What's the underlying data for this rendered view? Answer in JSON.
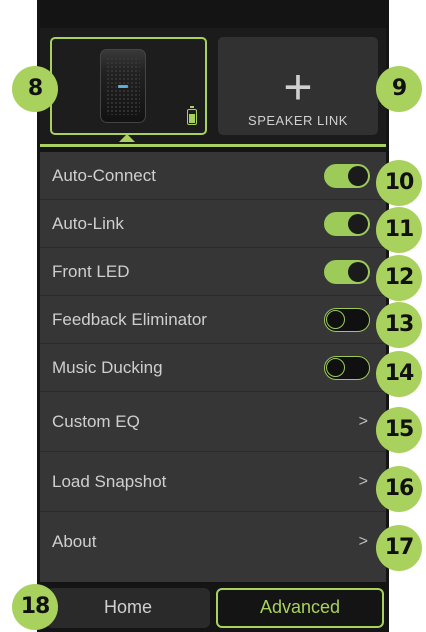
{
  "device_card": {
    "battery_icon": "battery-icon"
  },
  "speaker_link": {
    "plus": "+",
    "label": "SPEAKER LINK"
  },
  "settings": {
    "toggles": [
      {
        "label": "Auto-Connect",
        "state": "on"
      },
      {
        "label": "Auto-Link",
        "state": "on"
      },
      {
        "label": "Front LED",
        "state": "on"
      },
      {
        "label": "Feedback Eliminator",
        "state": "off"
      },
      {
        "label": "Music Ducking",
        "state": "off"
      }
    ],
    "links": [
      {
        "label": "Custom EQ",
        "chevron": ">"
      },
      {
        "label": "Load Snapshot",
        "chevron": ">"
      },
      {
        "label": "About",
        "chevron": ">"
      }
    ]
  },
  "tabs": {
    "home": "Home",
    "advanced": "Advanced",
    "active": "Advanced"
  },
  "callouts": [
    "8",
    "9",
    "10",
    "11",
    "12",
    "13",
    "14",
    "15",
    "16",
    "17",
    "18"
  ],
  "colors": {
    "accent": "#a9d15d",
    "background": "#141414",
    "row": "#363636"
  }
}
